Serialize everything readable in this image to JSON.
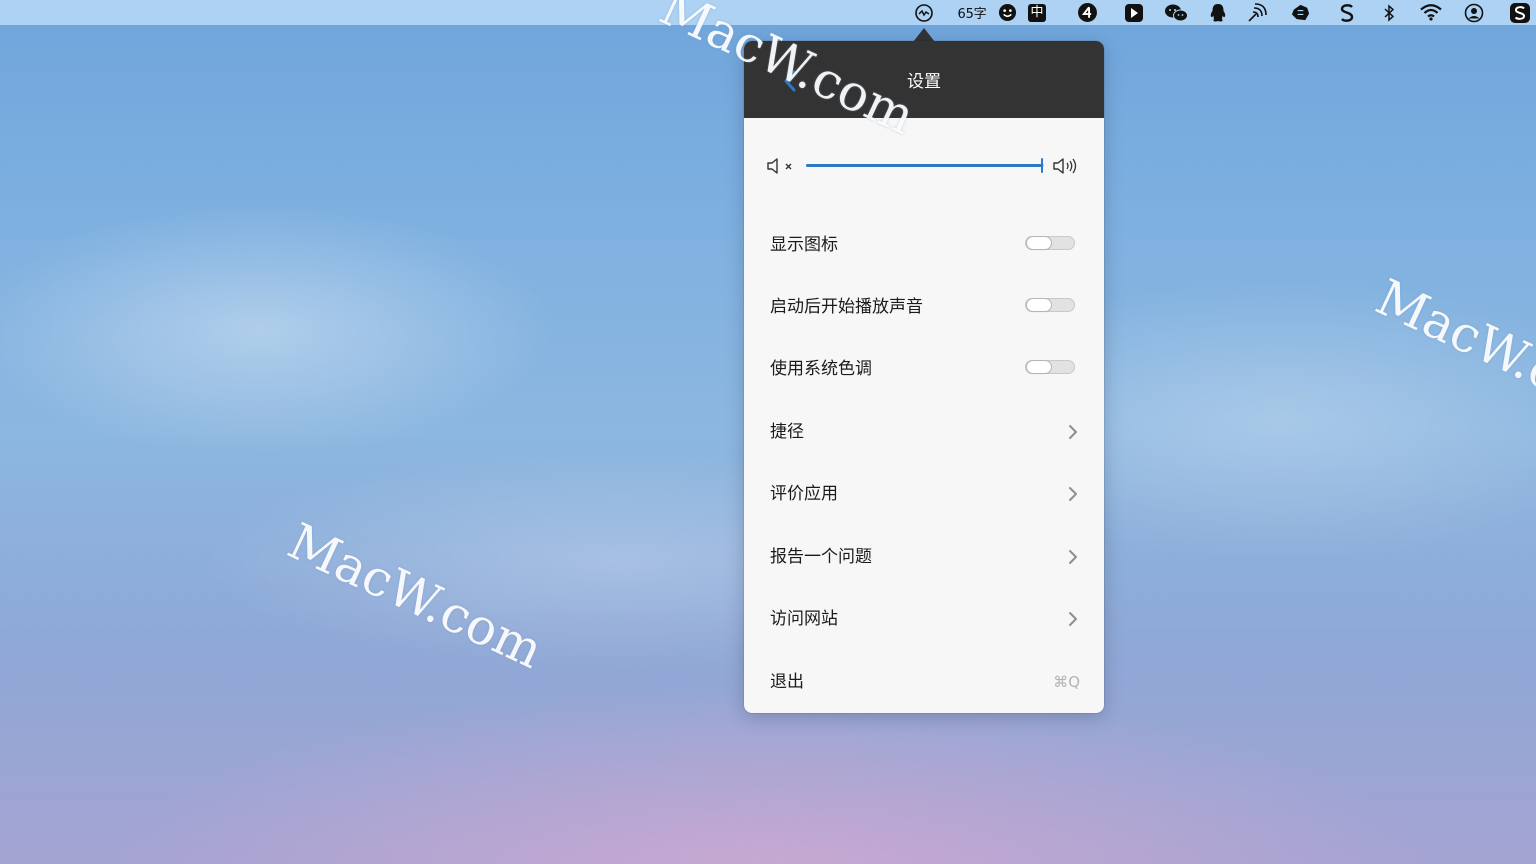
{
  "menubar": {
    "word_count": "65字",
    "items": [
      {
        "icon": "activity-monitor-icon"
      },
      {
        "icon": "smiley-icon"
      },
      {
        "icon": "input-method-zh-icon",
        "text": "中"
      },
      {
        "icon": "number-4-icon"
      },
      {
        "icon": "play-app-icon"
      },
      {
        "icon": "wechat-icon"
      },
      {
        "icon": "qq-icon"
      },
      {
        "icon": "airdrop-icon"
      },
      {
        "icon": "app-icon"
      },
      {
        "icon": "s-app-icon"
      },
      {
        "icon": "bluetooth-icon"
      },
      {
        "icon": "wifi-icon"
      },
      {
        "icon": "user-icon"
      },
      {
        "icon": "s-square-app-icon"
      }
    ]
  },
  "watermarks": [
    "MacW.com",
    "MacW.com",
    "MacW.c"
  ],
  "popover": {
    "title": "设置",
    "accent_color": "#2f78c4",
    "header_color": "#333333",
    "volume": {
      "level": 0.99,
      "mute_icon": "volume-mute-icon",
      "max_icon": "volume-max-icon"
    },
    "toggles": [
      {
        "label": "显示图标",
        "on": false
      },
      {
        "label": "启动后开始播放声音",
        "on": false
      },
      {
        "label": "使用系统色调",
        "on": false
      }
    ],
    "links": [
      {
        "label": "捷径"
      },
      {
        "label": "评价应用"
      },
      {
        "label": "报告一个问题"
      },
      {
        "label": "访问网站"
      }
    ],
    "quit": {
      "label": "退出",
      "shortcut": "⌘Q"
    }
  }
}
